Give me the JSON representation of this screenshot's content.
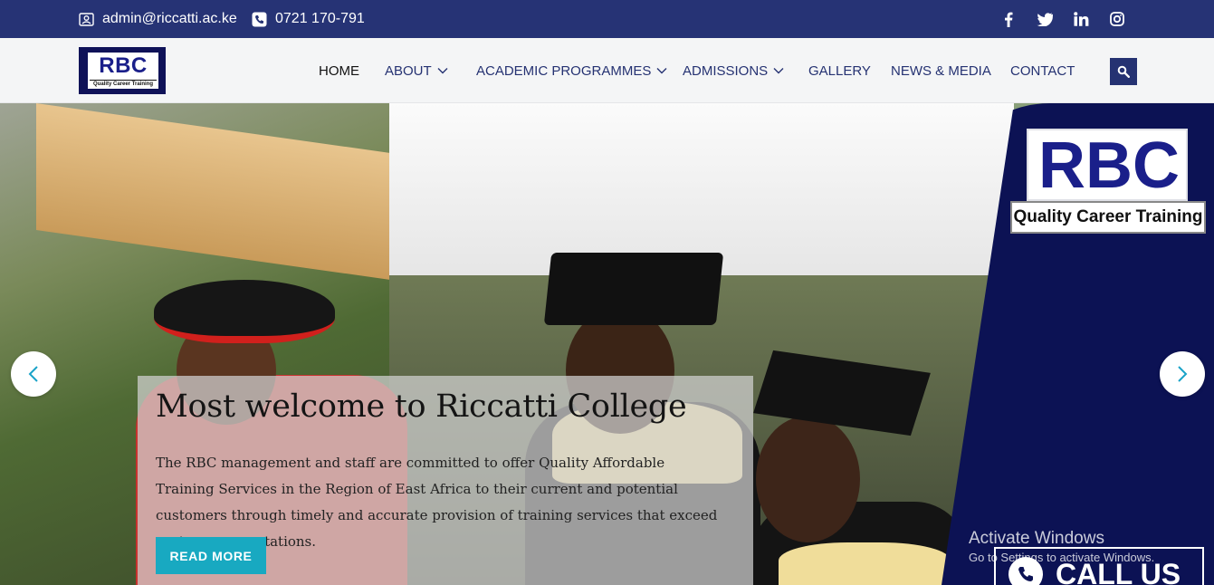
{
  "topbar": {
    "email": "admin@riccatti.ac.ke",
    "phone": "0721 170-791",
    "socials": [
      "facebook-icon",
      "twitter-icon",
      "linkedin-icon",
      "instagram-icon"
    ]
  },
  "logo": {
    "text": "RBC",
    "tagline": "Quality Career Training"
  },
  "nav": {
    "items": [
      {
        "label": "HOME",
        "has_dropdown": false,
        "active": true
      },
      {
        "label": "ABOUT",
        "has_dropdown": true
      },
      {
        "label": "ACADEMIC PROGRAMMES",
        "has_dropdown": true
      },
      {
        "label": "ADMISSIONS",
        "has_dropdown": true
      },
      {
        "label": "GALLERY",
        "has_dropdown": false
      },
      {
        "label": "NEWS & MEDIA",
        "has_dropdown": false
      },
      {
        "label": "CONTACT",
        "has_dropdown": false
      }
    ],
    "search_icon": "search-icon"
  },
  "hero": {
    "title": "Most welcome to Riccatti College",
    "body": "The RBC management and staff are committed to offer Quality Affordable Training Services in the Region of East Africa to their current and potential customers through timely and accurate provision of training services that exceed customer expectations.",
    "cta": "READ MORE",
    "brand_text": "RBC",
    "brand_tagline": "Quality Career Training",
    "call_text": "CALL US"
  },
  "watermark": {
    "line1": "Activate Windows",
    "line2": "Go to Settings to activate Windows."
  },
  "colors": {
    "topbar": "#263375",
    "nav_text": "#253272",
    "cta": "#18a9c1",
    "panel": "#0c1254"
  }
}
